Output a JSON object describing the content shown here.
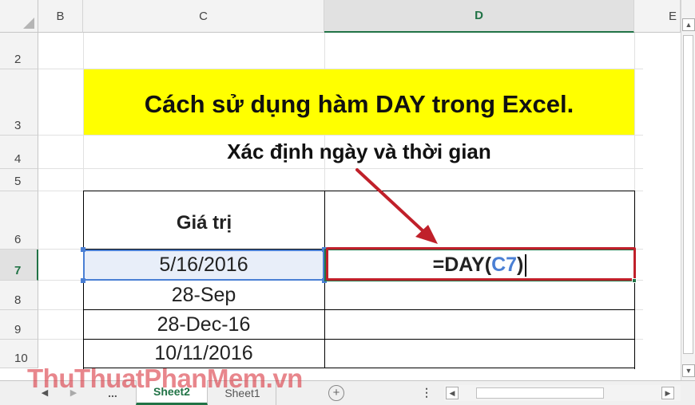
{
  "columns": [
    "B",
    "C",
    "D",
    "E"
  ],
  "rows": [
    "2",
    "3",
    "4",
    "5",
    "6",
    "7",
    "8",
    "9",
    "10"
  ],
  "title": "Cách sử dụng hàm DAY trong Excel.",
  "subtitle": "Xác định ngày và thời gian",
  "table": {
    "header": "Giá trị",
    "values": [
      "5/16/2016",
      "28-Sep",
      "28-Dec-16",
      "10/11/2016"
    ]
  },
  "formula": {
    "prefix": "=DAY(",
    "reference": "C7",
    "suffix": ")"
  },
  "sheet_tabs": {
    "ellipsis": "...",
    "active": "Sheet2",
    "other": "Sheet1",
    "add_symbol": "+"
  },
  "watermark": "ThuThuatPhanMem.vn",
  "colors": {
    "title_fill": "#ffff00",
    "excel_green": "#217346",
    "annotation_red": "#c0202a",
    "reference_blue": "#4a7fd4"
  }
}
